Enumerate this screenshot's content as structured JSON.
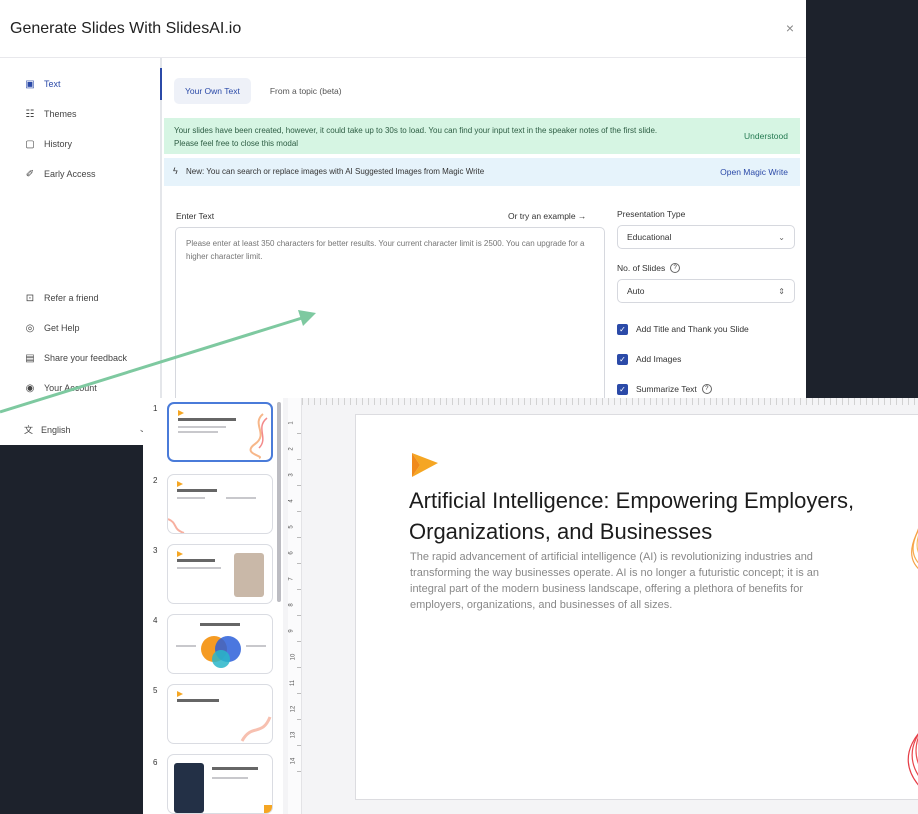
{
  "modal": {
    "title": "Generate Slides With SlidesAI.io",
    "close_label": "×"
  },
  "sidebar": {
    "items": [
      {
        "label": "Text",
        "icon": "document-icon",
        "active": true
      },
      {
        "label": "Themes",
        "icon": "themes-icon"
      },
      {
        "label": "History",
        "icon": "history-icon"
      },
      {
        "label": "Early Access",
        "icon": "early-access-icon"
      }
    ],
    "bottom_items": [
      {
        "label": "Refer a friend",
        "icon": "gift-icon"
      },
      {
        "label": "Get Help",
        "icon": "help-icon"
      },
      {
        "label": "Share your feedback",
        "icon": "feedback-icon"
      },
      {
        "label": "Your Account",
        "icon": "account-icon"
      }
    ],
    "language": "English"
  },
  "tabs": [
    {
      "label": "Your Own Text",
      "active": true
    },
    {
      "label": "From a topic (beta)"
    }
  ],
  "banners": {
    "success_text": "Your slides have been created, however, it could take up to 30s to load. You can find your input text in the speaker notes of the first slide. Please feel free to close this modal",
    "success_action": "Understood",
    "info_text": "New: You can search or replace images with AI Suggested Images from Magic Write",
    "info_action": "Open Magic Write"
  },
  "form": {
    "enter_text_label": "Enter Text",
    "example_link": "Or try an example →",
    "textarea_placeholder": "Please enter at least 350 characters for better results. Your current character limit is 2500. You can upgrade for a higher character limit.",
    "presentation_type_label": "Presentation Type",
    "presentation_type_value": "Educational",
    "slides_label": "No. of Slides",
    "slides_value": "Auto",
    "checkboxes": [
      {
        "label": "Add Title and Thank you Slide",
        "checked": true
      },
      {
        "label": "Add Images",
        "checked": true
      },
      {
        "label": "Summarize Text",
        "checked": true
      }
    ]
  },
  "editor": {
    "thumbnail_numbers": [
      "1",
      "2",
      "3",
      "4",
      "5",
      "6"
    ],
    "ruler_numbers": [
      "1",
      "2",
      "3",
      "4",
      "5",
      "6",
      "7",
      "8",
      "9",
      "10",
      "11",
      "12",
      "13",
      "14"
    ],
    "slide": {
      "title": "Artificial Intelligence: Empowering Employers, Organizations, and Businesses",
      "body": "The rapid advancement of artificial intelligence (AI) is revolutionizing industries and transforming the way businesses operate. AI is no longer a futuristic concept; it is an integral part of the modern business landscape, offering a plethora of benefits for employers, organizations, and businesses of all sizes."
    }
  },
  "colors": {
    "accent": "#2b4aa8",
    "success_banner": "#d6f5e3",
    "info_banner": "#e6f3fb",
    "arrow": "#7ec9a0",
    "logo": "#f5a623",
    "background": "#1d222c"
  }
}
